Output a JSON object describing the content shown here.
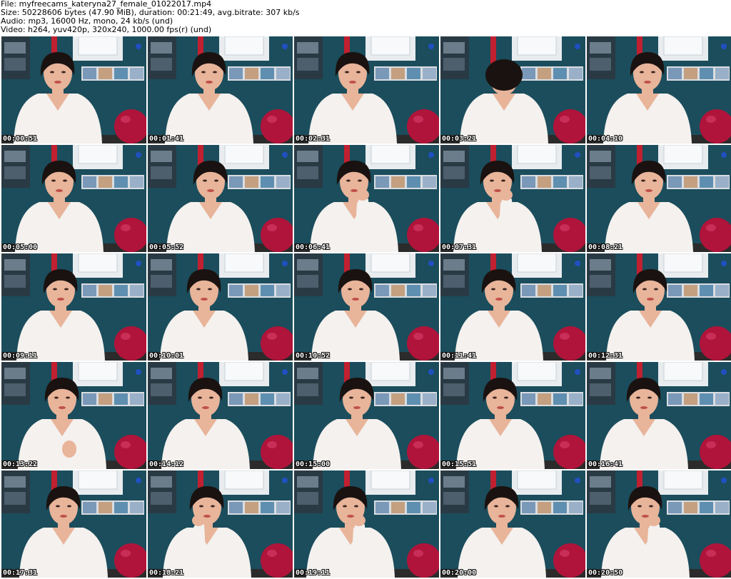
{
  "header": {
    "file_line": "File: myfreecams_kateryna27_female_01022017.mp4",
    "size_line": "Size: 50228606 bytes (47.90 MiB), duration: 00:21:49, avg.bitrate: 307 kb/s",
    "audio_line": "Audio: mp3, 16000 Hz, mono, 24 kb/s (und)",
    "video_line": "Video: h264, yuv420p, 320x240, 1000.00 fps(r) (und)"
  },
  "colors": {
    "wall": "#1b4d5c",
    "shirt": "#f4f1ee",
    "hair": "#1a1210",
    "skin": "#e8b49a",
    "ball": "#b0143a",
    "frame": "#e8ecef",
    "curtain": "#c02030"
  },
  "thumbnails": [
    {
      "timestamp": "00:00:51",
      "pose": "normal"
    },
    {
      "timestamp": "00:01:41",
      "pose": "normal"
    },
    {
      "timestamp": "00:02:31",
      "pose": "normal"
    },
    {
      "timestamp": "00:03:21",
      "pose": "head-down"
    },
    {
      "timestamp": "00:04:10",
      "pose": "normal"
    },
    {
      "timestamp": "00:05:00",
      "pose": "normal"
    },
    {
      "timestamp": "00:05:52",
      "pose": "normal"
    },
    {
      "timestamp": "00:06:41",
      "pose": "hand-chin"
    },
    {
      "timestamp": "00:07:31",
      "pose": "hand-chin"
    },
    {
      "timestamp": "00:08:21",
      "pose": "normal"
    },
    {
      "timestamp": "00:09:11",
      "pose": "normal"
    },
    {
      "timestamp": "00:10:01",
      "pose": "normal"
    },
    {
      "timestamp": "00:10:52",
      "pose": "normal"
    },
    {
      "timestamp": "00:11:41",
      "pose": "normal"
    },
    {
      "timestamp": "00:12:31",
      "pose": "normal"
    },
    {
      "timestamp": "00:13:22",
      "pose": "hand-raised"
    },
    {
      "timestamp": "00:14:12",
      "pose": "normal"
    },
    {
      "timestamp": "00:15:00",
      "pose": "normal"
    },
    {
      "timestamp": "00:15:51",
      "pose": "normal"
    },
    {
      "timestamp": "00:16:41",
      "pose": "normal"
    },
    {
      "timestamp": "00:17:31",
      "pose": "normal"
    },
    {
      "timestamp": "00:18:21",
      "pose": "hand-cheek"
    },
    {
      "timestamp": "00:19:11",
      "pose": "hand-chin"
    },
    {
      "timestamp": "00:20:00",
      "pose": "normal"
    },
    {
      "timestamp": "00:20:50",
      "pose": "hand-chin"
    }
  ]
}
